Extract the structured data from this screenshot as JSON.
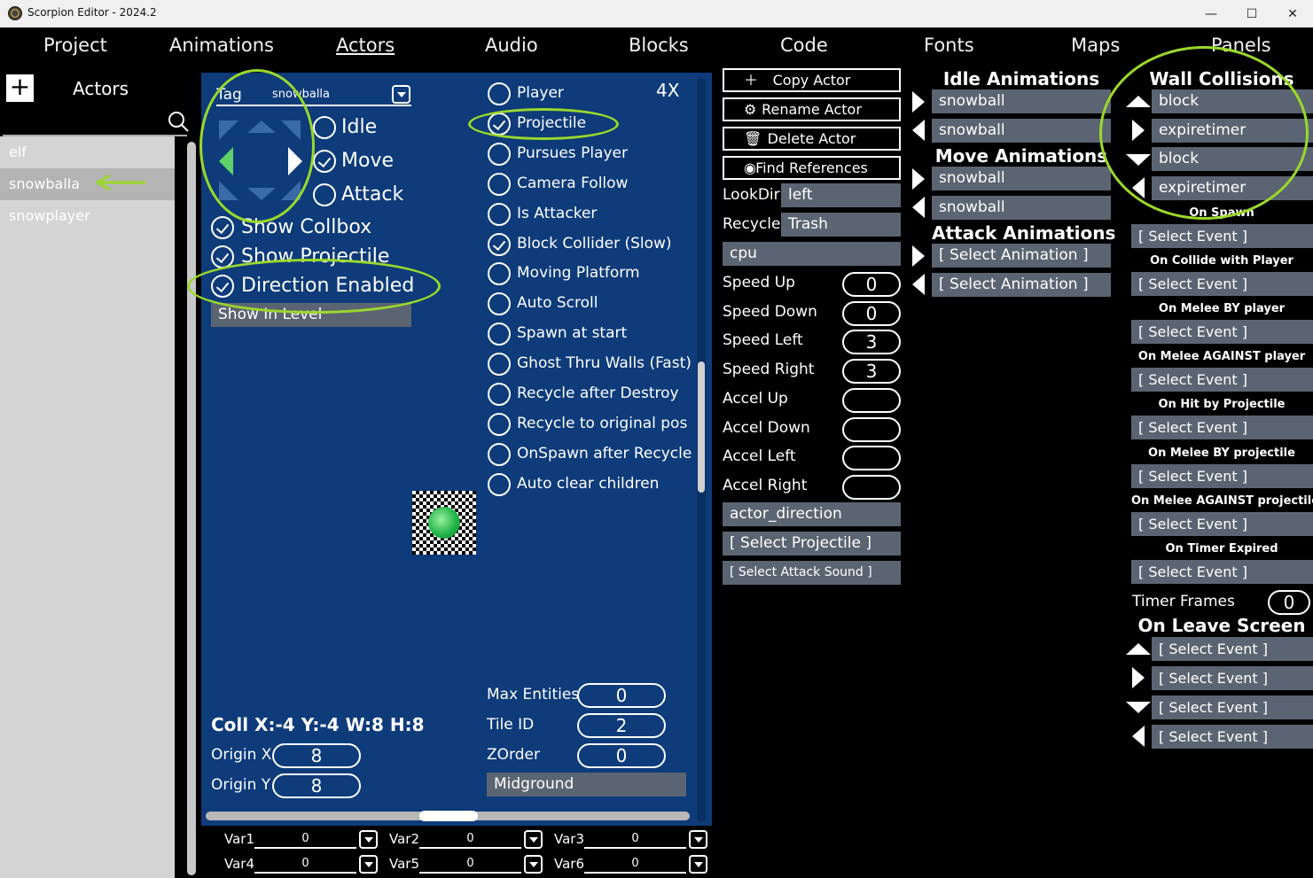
{
  "window": {
    "title": "Scorpion Editor - 2024.2",
    "minimize": "—",
    "maximize": "☐",
    "close": "✕"
  },
  "menu": [
    "Project",
    "Animations",
    "Actors",
    "Audio",
    "Blocks",
    "Code",
    "Fonts",
    "Maps",
    "Panels"
  ],
  "left": {
    "add_label": "+",
    "title": "Actors",
    "actors": [
      "elf",
      "snowballa",
      "snowplayer"
    ],
    "selected": "snowballa"
  },
  "center": {
    "tag_label": "Tag",
    "tag_value": "snowballa",
    "zoom": "4X",
    "anim_modes": [
      "Idle",
      "Move",
      "Attack"
    ],
    "show_collbox": "Show Collbox",
    "show_projectile": "Show Projectile",
    "direction_enabled": "Direction Enabled",
    "show_in_level": "Show In Level",
    "flags": [
      {
        "label": "Player",
        "checked": false
      },
      {
        "label": "Projectile",
        "checked": true
      },
      {
        "label": "Pursues Player",
        "checked": false
      },
      {
        "label": "Camera Follow",
        "checked": false
      },
      {
        "label": "Is Attacker",
        "checked": false
      },
      {
        "label": "Block Collider (Slow)",
        "checked": true
      },
      {
        "label": "Moving Platform",
        "checked": false
      },
      {
        "label": "Auto Scroll",
        "checked": false
      },
      {
        "label": "Spawn at start",
        "checked": false
      },
      {
        "label": "Ghost Thru Walls (Fast)",
        "checked": false
      },
      {
        "label": "Recycle after Destroy",
        "checked": false
      },
      {
        "label": "Recycle to original pos",
        "checked": false
      },
      {
        "label": "OnSpawn after Recycle",
        "checked": false
      },
      {
        "label": "Auto clear children",
        "checked": false
      }
    ],
    "coll_info": "Coll X:-4 Y:-4 W:8 H:8",
    "origin_x_label": "Origin X",
    "origin_x": "8",
    "origin_y_label": "Origin Y",
    "origin_y": "8",
    "max_entities_label": "Max Entities",
    "max_entities": "0",
    "tile_id_label": "Tile ID",
    "tile_id": "2",
    "zorder_label": "ZOrder",
    "zorder": "0",
    "layer": "Midground"
  },
  "vars": [
    {
      "label": "Var1",
      "value": "0"
    },
    {
      "label": "Var2",
      "value": "0"
    },
    {
      "label": "Var3",
      "value": "0"
    },
    {
      "label": "Var4",
      "value": "0"
    },
    {
      "label": "Var5",
      "value": "0"
    },
    {
      "label": "Var6",
      "value": "0"
    }
  ],
  "props": {
    "copy": "Copy Actor",
    "rename": "Rename Actor",
    "delete": "Delete Actor",
    "find": "Find References",
    "lookdir_label": "LookDir",
    "lookdir": "left",
    "recycle_label": "Recycle",
    "recycle": "Trash",
    "controller": "cpu",
    "speeds": [
      {
        "label": "Speed Up",
        "value": "0"
      },
      {
        "label": "Speed Down",
        "value": "0"
      },
      {
        "label": "Speed Left",
        "value": "3"
      },
      {
        "label": "Speed Right",
        "value": "3"
      },
      {
        "label": "Accel Up",
        "value": ""
      },
      {
        "label": "Accel Down",
        "value": ""
      },
      {
        "label": "Accel Left",
        "value": ""
      },
      {
        "label": "Accel Right",
        "value": ""
      }
    ],
    "direction_var": "actor_direction",
    "projectile": "[ Select Projectile ]",
    "attack_sound": "[ Select Attack Sound ]"
  },
  "animations": {
    "idle_title": "Idle Animations",
    "idle": [
      "snowball",
      "snowball"
    ],
    "move_title": "Move Animations",
    "move": [
      "snowball",
      "snowball"
    ],
    "attack_title": "Attack Animations",
    "attack": [
      "[ Select Animation ]",
      "[ Select Animation ]"
    ]
  },
  "events": {
    "wall_title": "Wall Collisions",
    "walls": [
      "block",
      "expiretimer",
      "block",
      "expiretimer"
    ],
    "items": [
      {
        "label": "On Spawn",
        "value": "[ Select Event ]"
      },
      {
        "label": "On Collide with Player",
        "value": "[ Select Event ]"
      },
      {
        "label": "On Melee BY player",
        "value": "[ Select Event ]"
      },
      {
        "label": "On Melee AGAINST player",
        "value": "[ Select Event ]"
      },
      {
        "label": "On Hit by Projectile",
        "value": "[ Select Event ]"
      },
      {
        "label": "On Melee BY projectile",
        "value": "[ Select Event ]"
      },
      {
        "label": "On Melee AGAINST projectile",
        "value": "[ Select Event ]"
      },
      {
        "label": "On Timer Expired",
        "value": "[ Select Event ]"
      }
    ],
    "timer_label": "Timer Frames",
    "timer_value": "0",
    "leave_title": "On Leave Screen",
    "leave": [
      "[ Select Event ]",
      "[ Select Event ]",
      "[ Select Event ]",
      "[ Select Event ]"
    ]
  },
  "colors": {
    "panel_blue": "#0e3b7a",
    "field_gray": "#5b6472",
    "highlight": "#9ad82a"
  }
}
